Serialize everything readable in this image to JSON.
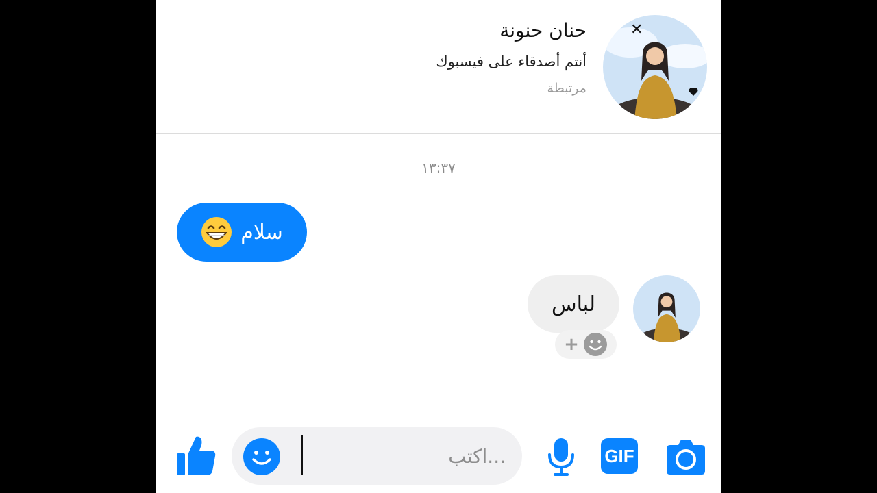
{
  "colors": {
    "accent": "#0a84ff",
    "received_bubble": "#efefef",
    "composer_bg": "#f1f1f3"
  },
  "header": {
    "name": "حنان حنونة",
    "subtitle": "أنتم أصدقاء على فيسبوك",
    "status": "مرتبطة",
    "avatar_icon": "profile-photo-icon"
  },
  "conversation": {
    "timestamp": "١٣:٣٧",
    "messages": [
      {
        "direction": "sent",
        "text": "سلام",
        "emoji": "grinning-face-icon"
      },
      {
        "direction": "received",
        "text": "لباس",
        "reaction_icon": "add-reaction-icon"
      }
    ],
    "reaction_plus": "+"
  },
  "composer": {
    "placeholder": "...اكتب",
    "value": "",
    "gif_label": "GIF",
    "icons": [
      "like-icon",
      "emoji-icon",
      "microphone-icon",
      "gif-icon",
      "camera-icon"
    ]
  }
}
